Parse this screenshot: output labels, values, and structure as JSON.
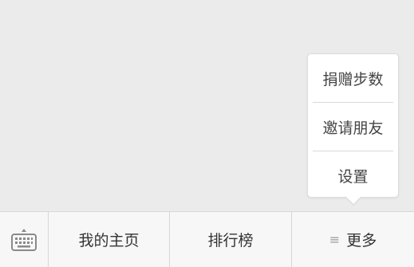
{
  "popup_menu": {
    "items": [
      {
        "label": "捐赠步数"
      },
      {
        "label": "邀请朋友"
      },
      {
        "label": "设置"
      }
    ]
  },
  "bottom_bar": {
    "keyboard_icon": "keyboard-icon",
    "tabs": [
      {
        "label": "我的主页"
      },
      {
        "label": "排行榜"
      },
      {
        "label": "更多",
        "icon": "menu-lines-icon",
        "icon_glyph": "≡"
      }
    ]
  },
  "colors": {
    "background": "#ebebeb",
    "bar_background": "#f7f7f7",
    "text": "#333333",
    "divider": "#d7d7d7"
  }
}
